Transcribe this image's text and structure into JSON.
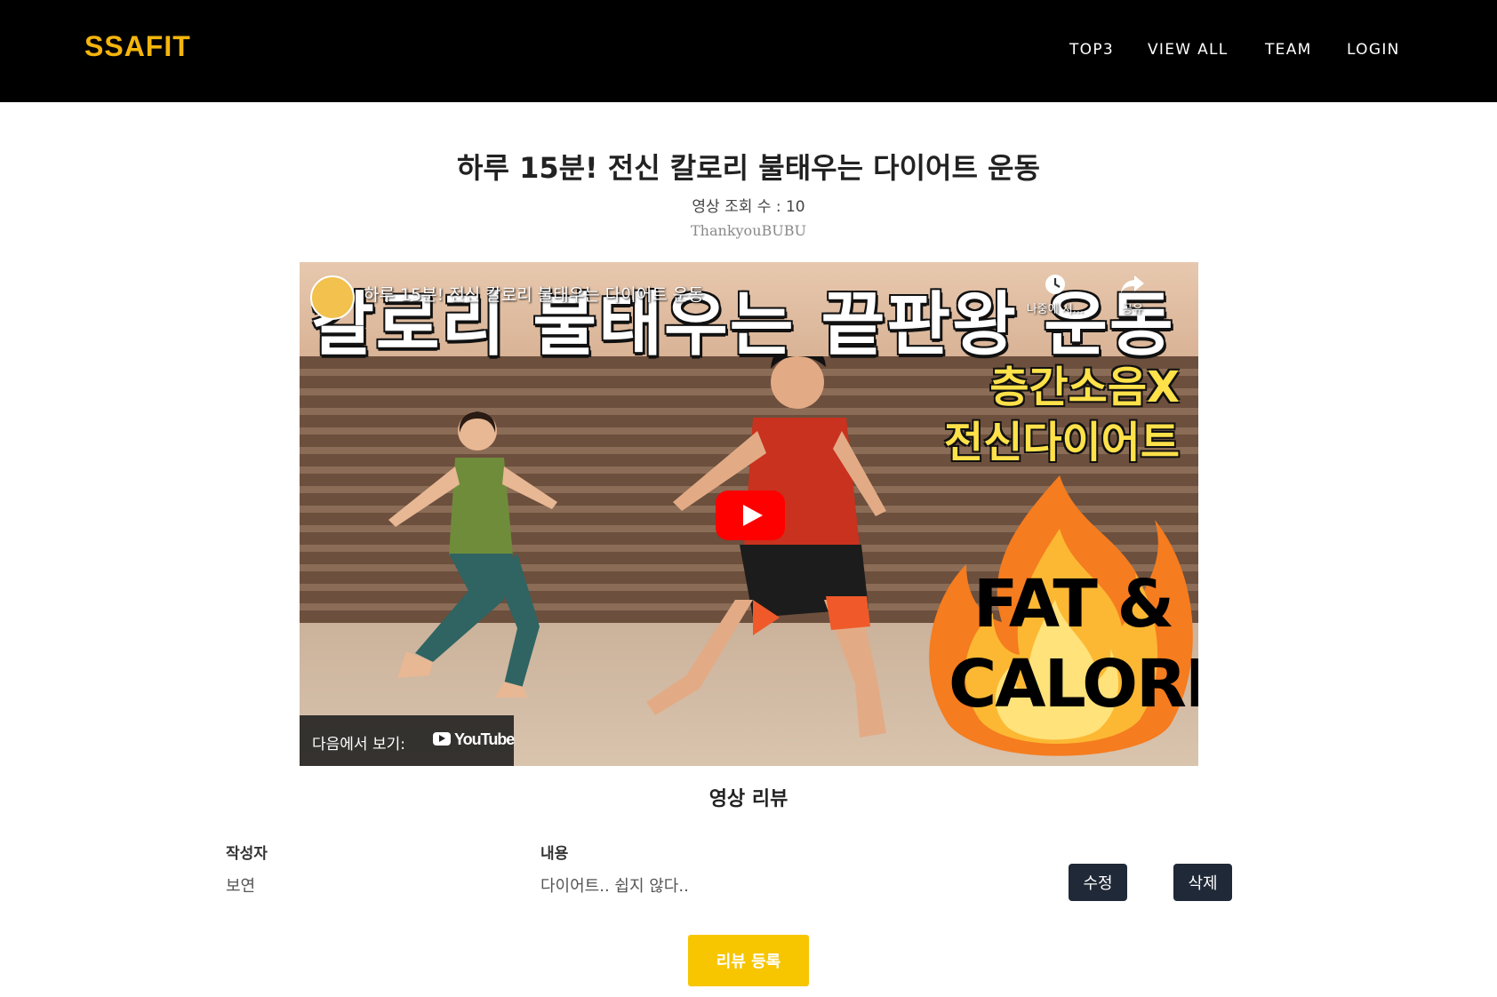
{
  "nav": {
    "brand": "SSAFIT",
    "links": [
      "TOP3",
      "VIEW ALL",
      "TEAM",
      "LOGIN"
    ]
  },
  "video": {
    "title": "하루 15분! 전신 칼로리 불태우는 다이어트 운동",
    "view_count": "영상 조회 수 : 10",
    "channel": "ThankyouBUBU",
    "player": {
      "title": "하루 15분! 전신 칼로리 불태우는 다이어트 운동",
      "watch_later": "나중에 시...",
      "share": "공유",
      "watch_on": "다음에서 보기:",
      "youtube_label": "YouTube",
      "thumbnail_banner": "칼로리 불태우는 끝판왕 운동",
      "thumbnail_headline_1": "층간소음X",
      "thumbnail_headline_2": "전신다이어트",
      "thumbnail_fat": "FAT &",
      "thumbnail_calorie": "CALORIE"
    }
  },
  "reviews": {
    "heading": "영상 리뷰",
    "columns": {
      "author": "작성자",
      "content": "내용"
    },
    "rows": [
      {
        "author": "보연",
        "content": "다이어트.. 쉽지 않다..",
        "edit_label": "수정",
        "delete_label": "삭제"
      }
    ],
    "register_label": "리뷰 등록"
  },
  "colors": {
    "brand": "#f5b50c",
    "navbar": "#000000",
    "button_dark": "#1f2937",
    "button_accent": "#f7c600",
    "youtube_red": "#ff0000"
  }
}
